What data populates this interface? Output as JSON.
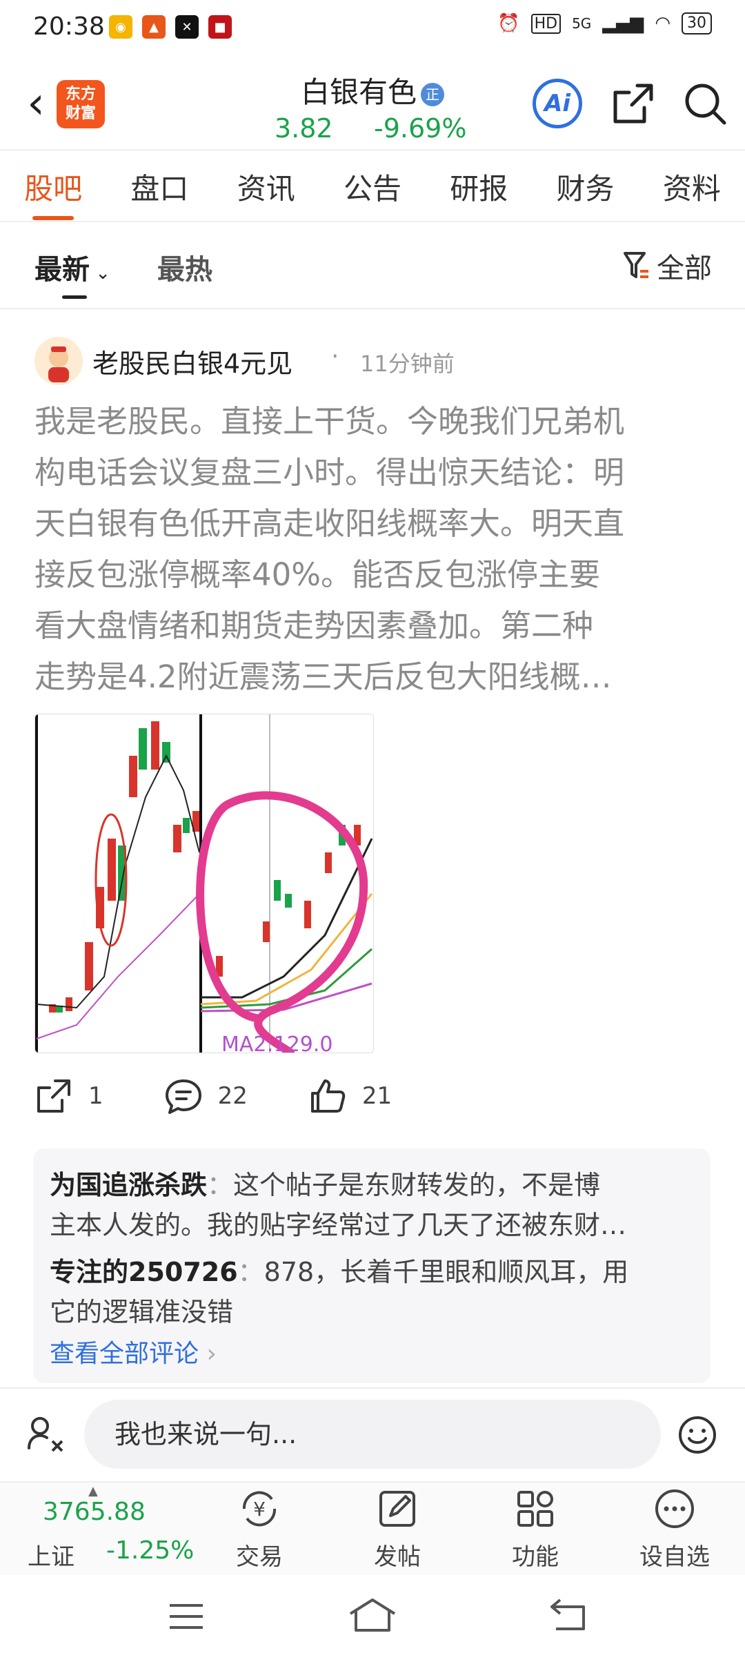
{
  "status_bar": {
    "time": "20:38",
    "network": "5G",
    "hd": "HD",
    "battery": "30"
  },
  "header": {
    "stock_name": "白银有色",
    "verified_badge": "正",
    "price": "3.82",
    "change": "-9.69%",
    "ai_label": "Ai",
    "logo_text": "东方财富"
  },
  "tabs": [
    "股吧",
    "盘口",
    "资讯",
    "公告",
    "研报",
    "财务",
    "资料"
  ],
  "subtabs": {
    "newest": "最新",
    "hot": "最热",
    "filter": "全部"
  },
  "post": {
    "author": "老股民白银4元见",
    "time": "11分钟前",
    "lines": [
      "我是老股民。直接上干货。今晚我们兄弟机",
      "构电话会议复盘三小时。得出惊天结论：明",
      "天白银有色低开高走收阳线概率大。明天直",
      "接反包涨停概率40%。能否反包涨停主要",
      "看大盘情绪和期货走势因素叠加。第二种",
      "走势是4.2附近震荡三天后反包大阳线概…"
    ],
    "image_caption": "MA2:129.0",
    "shares": "1",
    "comments_count": "22",
    "likes": "21"
  },
  "comments": [
    {
      "name": "为国追涨杀跌",
      "sep": "：",
      "text_1": "这个帖子是东财转发的，不是博",
      "text_2": "主本人发的。我的贴字经常过了几天了还被东财…"
    },
    {
      "name": "专注的250726",
      "sep": "：",
      "text_1": "878，长着千里眼和顺风耳，用",
      "text_2": "它的逻辑准没错"
    }
  ],
  "view_all": "查看全部评论",
  "input_placeholder": "我也来说一句...",
  "bottom": {
    "index_value": "3765.88",
    "index_name": "上证",
    "index_change": "-1.25%",
    "tools": [
      "交易",
      "发帖",
      "功能",
      "设自选"
    ]
  },
  "colors": {
    "accent": "#e8561a",
    "down": "#1aa34a",
    "link": "#2f6fe0"
  }
}
